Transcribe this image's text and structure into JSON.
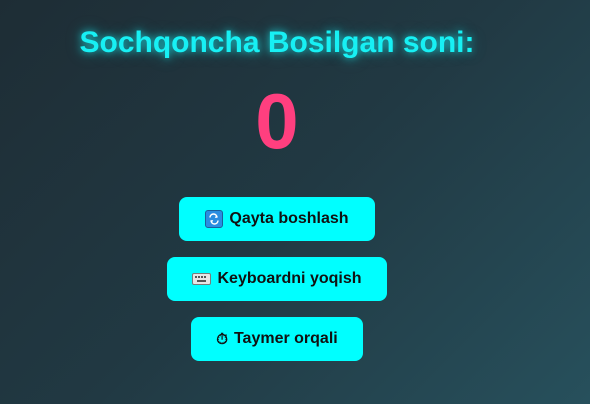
{
  "header": {
    "title": "Sochqoncha Bosilgan soni:"
  },
  "counter": {
    "value": "0"
  },
  "buttons": {
    "restart": {
      "label": "Qayta boshlash",
      "icon": "restart-icon"
    },
    "keyboard": {
      "label": "Keyboardni yoqish",
      "icon": "keyboard-icon"
    },
    "timer": {
      "label": "Taymer orqali",
      "icon": "stopwatch-icon",
      "glyph": "⏱"
    }
  },
  "colors": {
    "title": "#17f0f4",
    "counter": "#ff3f7f",
    "button_bg": "#00ffff",
    "background_start": "#1e2d35",
    "background_end": "#27505c"
  }
}
